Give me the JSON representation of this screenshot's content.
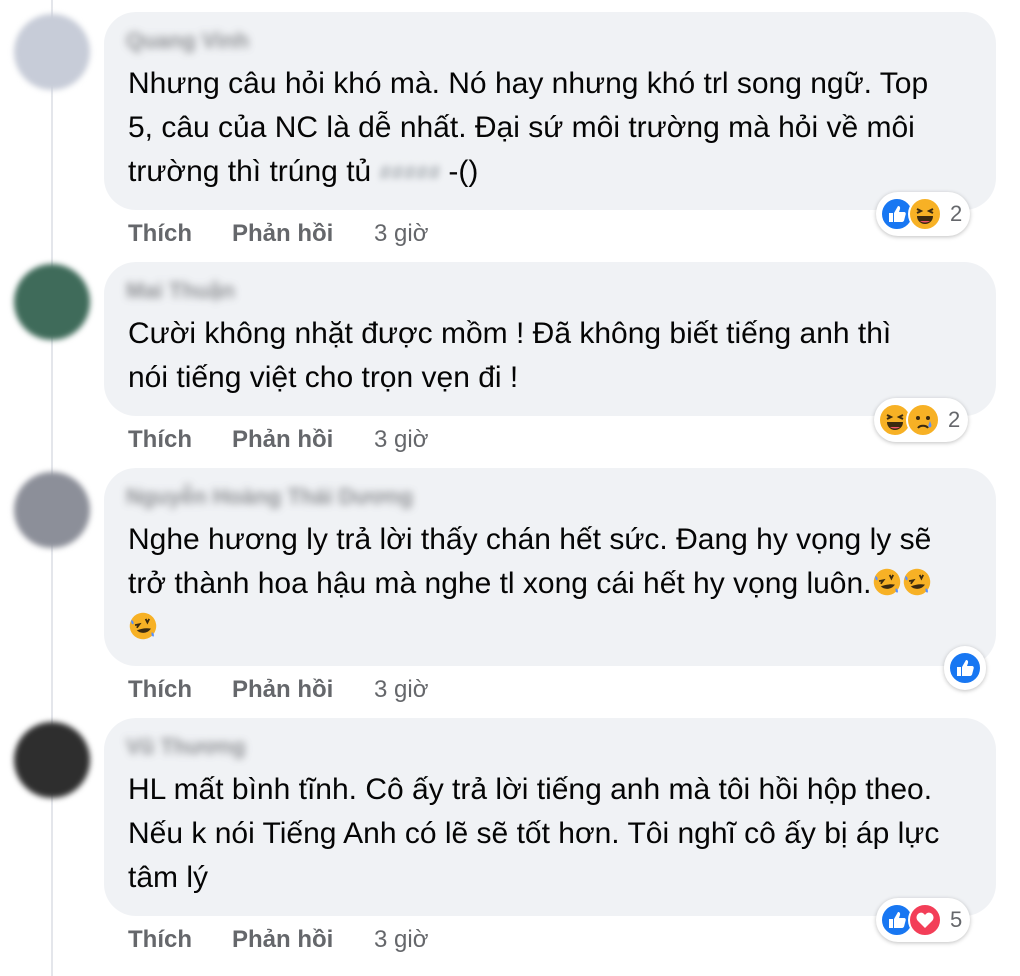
{
  "comments": [
    {
      "author": "Quang Vinh",
      "text": "Nhưng câu hỏi khó mà. Nó hay nhưng khó trl song ngữ. Top 5, câu của NC là dễ nhất. Đại sứ môi trường mà hỏi về môi trường thì trúng tủ",
      "text_tail": "-()",
      "blurred_word": "#####",
      "actions": {
        "like": "Thích",
        "reply": "Phản hồi",
        "time": "3 giờ"
      },
      "reaction_count": "2",
      "reactions": [
        "like-icon",
        "haha-icon"
      ],
      "avatar_color": "#c7ccd8"
    },
    {
      "author": "Mai Thuận",
      "text": "Cười không nhặt được mồm ! Đã không biết tiếng anh thì nói tiếng việt cho trọn vẹn đi !",
      "actions": {
        "like": "Thích",
        "reply": "Phản hồi",
        "time": "3 giờ"
      },
      "reaction_count": "2",
      "reactions": [
        "haha-icon",
        "sad-icon"
      ],
      "avatar_color": "#3f6b5a"
    },
    {
      "author": "Nguyễn Hoàng Thái Dương",
      "text": "Nghe hương ly trả lời thấy chán hết sức. Đang hy vọng ly sẽ trở thành hoa hậu mà nghe tl xong cái hết hy vọng luôn.",
      "inline_emojis": [
        "rofl-icon",
        "rofl-icon",
        "rofl-icon"
      ],
      "actions": {
        "like": "Thích",
        "reply": "Phản hồi",
        "time": "3 giờ"
      },
      "reaction_count": "",
      "reactions": [
        "like-icon"
      ],
      "avatar_color": "#8c8f99"
    },
    {
      "author": "Vũ Thương",
      "text": "HL mất bình tĩnh. Cô ấy trả lời tiếng anh mà tôi hồi hộp theo. Nếu k nói Tiếng Anh có lẽ sẽ tốt hơn. Tôi nghĩ cô ấy bị áp lực tâm lý",
      "actions": {
        "like": "Thích",
        "reply": "Phản hồi",
        "time": "3 giờ"
      },
      "reaction_count": "5",
      "reactions": [
        "like-icon",
        "love-icon"
      ],
      "avatar_color": "#2e2e2e"
    }
  ],
  "colors": {
    "bubble": "#f0f2f5",
    "action_text": "#65676b",
    "like_blue": "#1877f2",
    "haha_yellow": "#f7b125",
    "love_red": "#f33e58"
  }
}
